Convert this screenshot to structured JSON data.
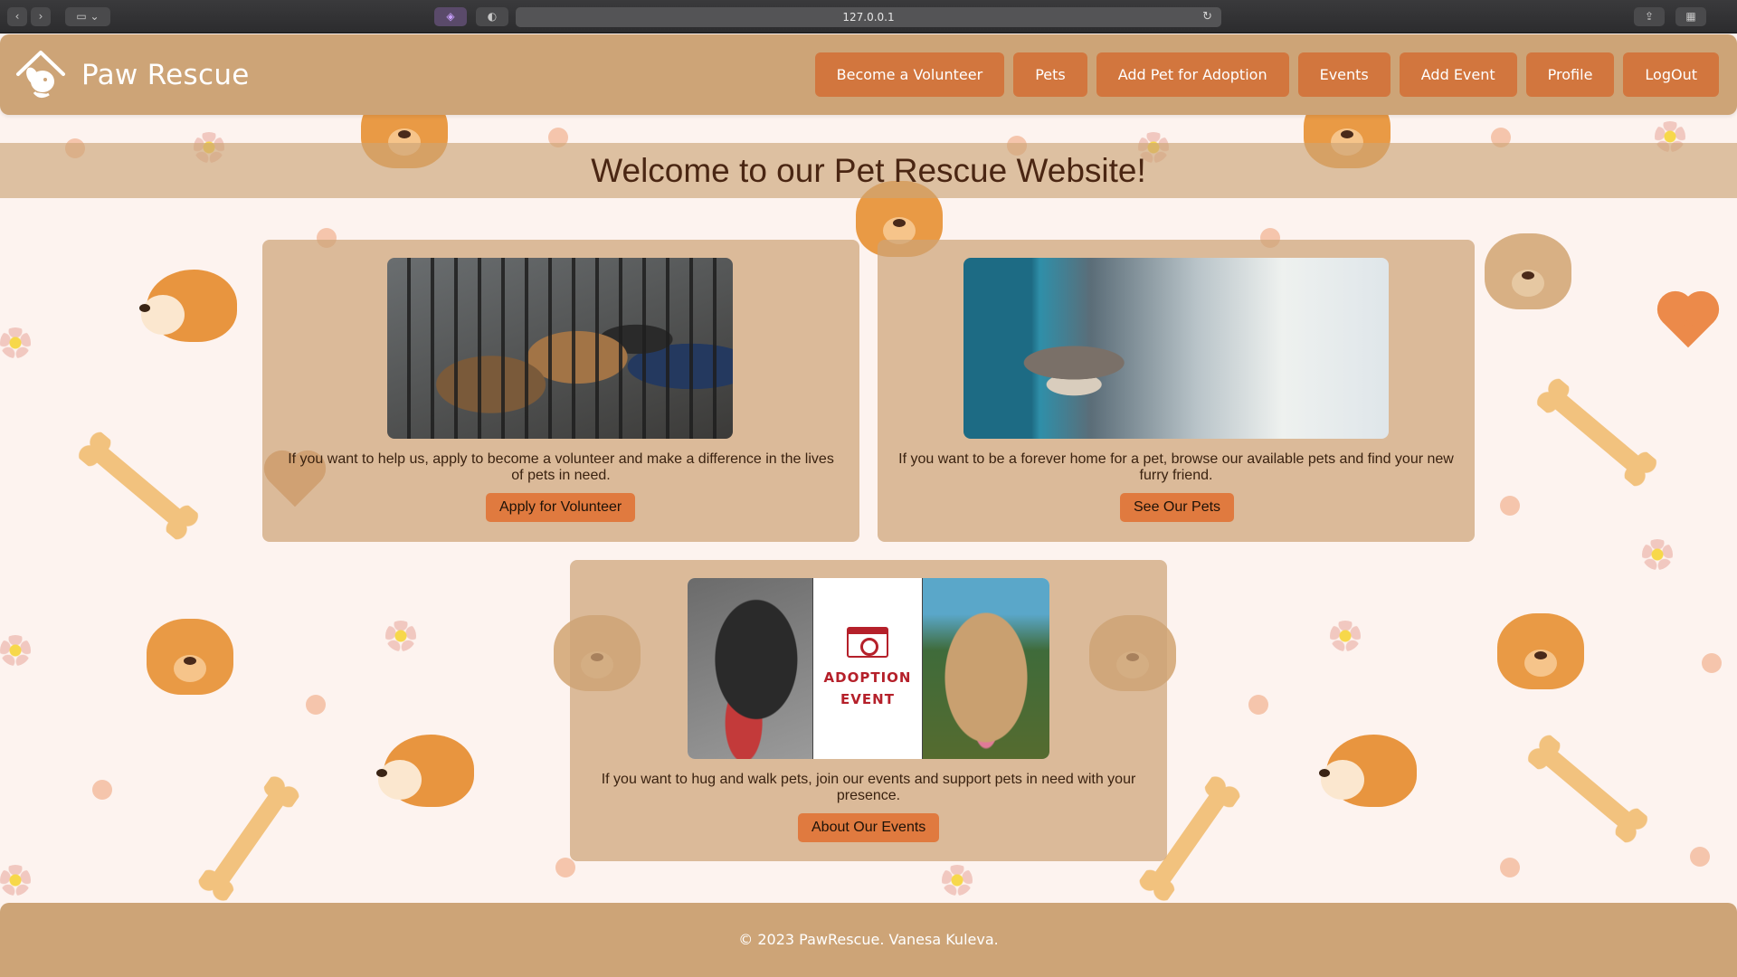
{
  "browser": {
    "address": "127.0.0.1"
  },
  "brand": {
    "name": "Paw Rescue"
  },
  "nav": {
    "items": [
      {
        "label": "Become a Volunteer"
      },
      {
        "label": "Pets"
      },
      {
        "label": "Add Pet for Adoption"
      },
      {
        "label": "Events"
      },
      {
        "label": "Add Event"
      },
      {
        "label": "Profile"
      },
      {
        "label": "LogOut"
      }
    ]
  },
  "welcome": {
    "title": "Welcome to our Pet Rescue Website!"
  },
  "cards": [
    {
      "text": "If you want to help us, apply to become a volunteer and make a difference in the lives of pets in need.",
      "button": "Apply for Volunteer"
    },
    {
      "text": "If you want to be a forever home for a pet, browse our available pets and find your new furry friend.",
      "button": "See Our Pets"
    },
    {
      "text": "If you want to hug and walk pets, join our events and support pets in need with your presence.",
      "button": "About Our Events",
      "image_text": "ADOPTION EVENT"
    }
  ],
  "footer": {
    "text": "© 2023 PawRescue. Vanesa Kuleva."
  },
  "colors": {
    "navbar": "#cda477",
    "button": "#d2763e",
    "cta": "#e07a3f",
    "background": "#fdf3ef"
  }
}
